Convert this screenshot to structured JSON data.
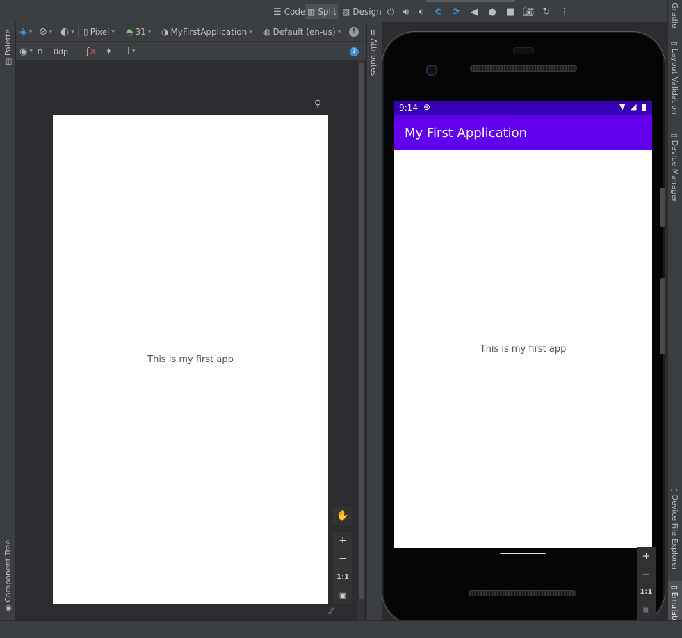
{
  "modes": {
    "code": "Code",
    "split": "Split",
    "design": "Design"
  },
  "left_strip": {
    "palette": "Palette",
    "component_tree": "Component Tree"
  },
  "design_toolbar": {
    "device": "Pixel",
    "api": "31",
    "theme": "MyFirstApplication",
    "locale": "Default (en-us)",
    "margin": "0dp"
  },
  "preview": {
    "text": "This is my first app"
  },
  "canvas_zoom": {
    "one_to_one": "1:1",
    "plus": "+",
    "minus": "−"
  },
  "attributes_strip": {
    "label": "Attributes"
  },
  "emulator": {
    "status_time": "9:14",
    "app_title": "My First Application",
    "content_text": "This is my first app",
    "zoom_plus": "+",
    "zoom_minus": "−",
    "zoom_one": "1:1"
  },
  "right_strip": {
    "gradle": "Gradle",
    "layout_validation": "Layout Validation",
    "device_manager": "Device Manager",
    "device_file_explorer": "Device File Explorer",
    "emulator": "Emulator"
  },
  "colors": {
    "status_bar": "#3700b3",
    "app_bar": "#6200ee",
    "ide_bg": "#3c3f41"
  }
}
